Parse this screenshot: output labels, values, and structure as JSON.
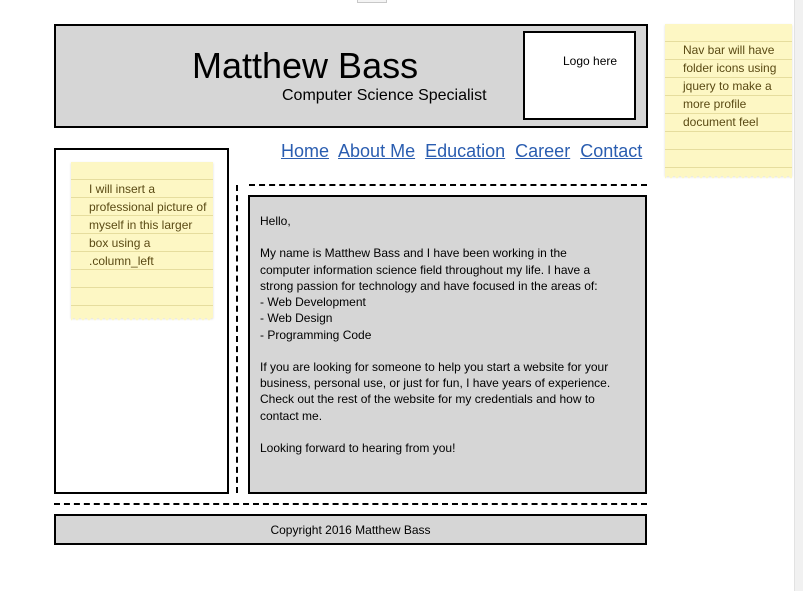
{
  "header": {
    "site_name": "Matthew Bass",
    "tagline": "Computer Science Specialist",
    "logo_placeholder": "Logo here"
  },
  "nav": {
    "items": [
      {
        "label": "Home"
      },
      {
        "label": "About Me"
      },
      {
        "label": "Education"
      },
      {
        "label": "Career"
      },
      {
        "label": "Contact"
      }
    ]
  },
  "notes": {
    "left": "I will insert a professional picture of myself in this larger box using a .column_left",
    "right": "Nav bar will have folder icons using jquery to make a more profile document feel"
  },
  "content": {
    "greeting": "Hello,",
    "intro": "My name is Matthew Bass and I have been working in the computer information science field throughout my life. I have a strong passion for technology and have focused in the areas of:",
    "focus_items": [
      "- Web Development",
      "- Web Design",
      "- Programming Code"
    ],
    "pitch": "If you are looking for someone to help you start a website for your business, personal use, or just for fun, I have years of experience. Check out the rest of the website for my credentials and how to contact me.",
    "closing": "Looking forward to hearing from you!"
  },
  "footer": {
    "copyright": "Copyright 2016 Matthew Bass"
  },
  "colors": {
    "panel_gray": "#d6d6d6",
    "link_blue": "#2a5db0",
    "sticky_yellow": "#fdf7c4"
  }
}
